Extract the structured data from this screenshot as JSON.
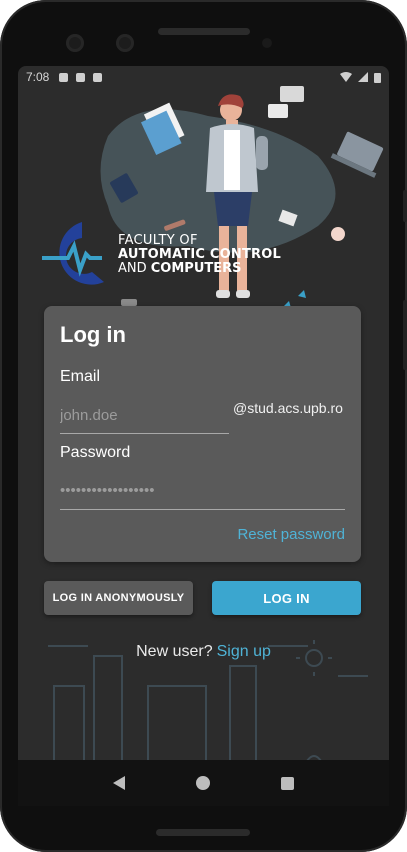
{
  "status": {
    "time": "7:08"
  },
  "brand": {
    "line1": "FACULTY OF",
    "line2": "AUTOMATIC CONTROL",
    "line3_a": "AND ",
    "line3_b": "COMPUTERS"
  },
  "login": {
    "title": "Log in",
    "email_label": "Email",
    "email_placeholder": "john.doe",
    "email_value": "",
    "domain_suffix": "@stud.acs.upb.ro",
    "password_label": "Password",
    "password_placeholder": "••••••••••••••••••",
    "reset_label": "Reset password"
  },
  "buttons": {
    "anonymous_label": "LOG IN ANONYMOUSLY",
    "login_label": "LOG IN"
  },
  "signup": {
    "prompt": "New user?",
    "link": "Sign up"
  },
  "colors": {
    "accent": "#3ba6cf",
    "card": "#5a5a5a",
    "background": "#2c2c2c"
  }
}
